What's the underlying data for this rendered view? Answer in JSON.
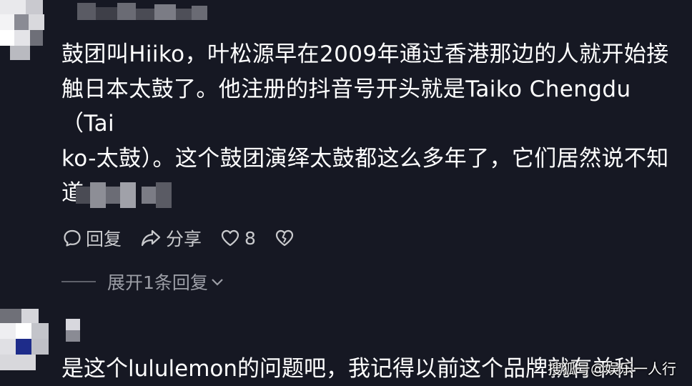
{
  "colors": {
    "background": "#161823",
    "text_primary": "#ffffff",
    "text_secondary": "#c9cacd",
    "text_muted": "#9c9ea6"
  },
  "comment": {
    "lines": [
      "鼓团叫Hiiko，叶松源早在2009年通过香港那边的人就开始接",
      "触日本太鼓了。他注册的抖音号开头就是Taiko Chengdu（Tai",
      "ko-太鼓）。这个鼓团演绎太鼓都这么多年了，它们居然说不知",
      "道"
    ],
    "emoji": "face-emoji"
  },
  "actions": {
    "reply_label": "回复",
    "share_label": "分享",
    "like_count": "8"
  },
  "expand_label": "展开1条回复",
  "second_comment": {
    "text": "是这个lululemon的问题吧，我记得以前这个品牌就有羊科"
  },
  "watermark": "搜狐号@娱乐一人行"
}
